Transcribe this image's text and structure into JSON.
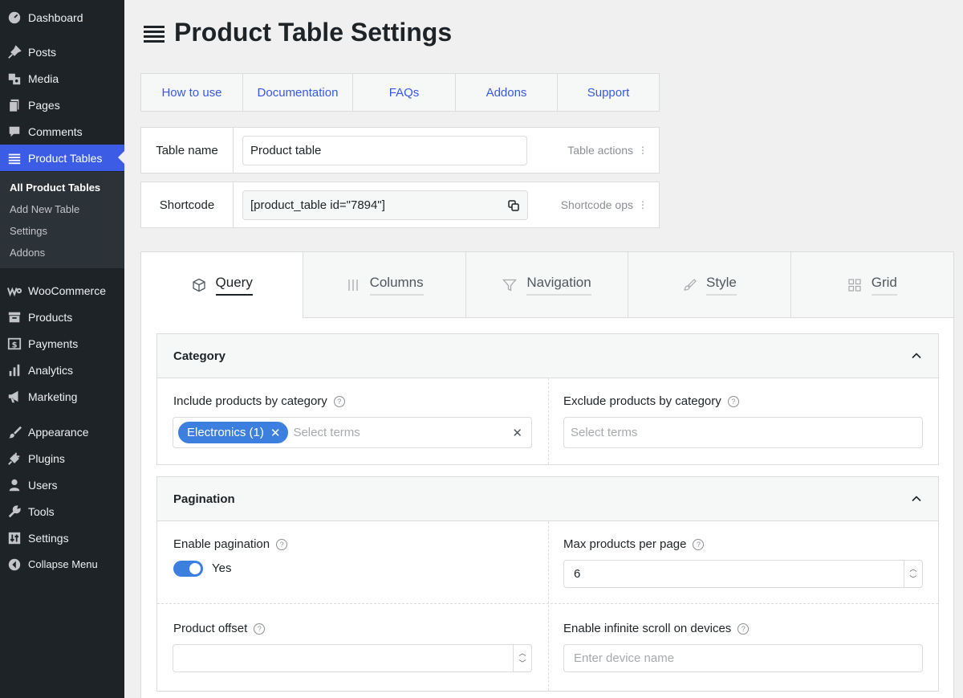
{
  "sidebar": {
    "items": [
      {
        "label": "Dashboard",
        "icon": "dashboard-icon"
      },
      {
        "label": "Posts",
        "icon": "pin-icon"
      },
      {
        "label": "Media",
        "icon": "media-icon"
      },
      {
        "label": "Pages",
        "icon": "pages-icon"
      },
      {
        "label": "Comments",
        "icon": "comment-icon"
      },
      {
        "label": "Product Tables",
        "icon": "list-icon"
      },
      {
        "label": "WooCommerce",
        "icon": "woocommerce-icon"
      },
      {
        "label": "Products",
        "icon": "archive-icon"
      },
      {
        "label": "Payments",
        "icon": "dollar-icon"
      },
      {
        "label": "Analytics",
        "icon": "bar-chart-icon"
      },
      {
        "label": "Marketing",
        "icon": "megaphone-icon"
      },
      {
        "label": "Appearance",
        "icon": "brush-icon"
      },
      {
        "label": "Plugins",
        "icon": "plug-icon"
      },
      {
        "label": "Users",
        "icon": "user-icon"
      },
      {
        "label": "Tools",
        "icon": "wrench-icon"
      },
      {
        "label": "Settings",
        "icon": "sliders-icon"
      },
      {
        "label": "Collapse Menu",
        "icon": "collapse-icon"
      }
    ],
    "submenu": [
      "All Product Tables",
      "Add New Table",
      "Settings",
      "Addons"
    ]
  },
  "header": {
    "title": "Product Table Settings"
  },
  "links": [
    "How to use",
    "Documentation",
    "FAQs",
    "Addons",
    "Support"
  ],
  "table_name": {
    "label": "Table name",
    "value": "Product table",
    "action": "Table actions"
  },
  "shortcode": {
    "label": "Shortcode",
    "value": "[product_table id=\"7894\"]",
    "action": "Shortcode ops"
  },
  "tabs": [
    "Query",
    "Columns",
    "Navigation",
    "Style",
    "Grid"
  ],
  "category": {
    "title": "Category",
    "include_label": "Include products by category",
    "include_chip": "Electronics (1)",
    "include_placeholder": "Select terms",
    "exclude_label": "Exclude products by category",
    "exclude_placeholder": "Select terms"
  },
  "pagination": {
    "title": "Pagination",
    "enable_label": "Enable pagination",
    "enable_value": "Yes",
    "max_label": "Max products per page",
    "max_value": "6",
    "offset_label": "Product offset",
    "offset_value": "",
    "infinite_label": "Enable infinite scroll on devices",
    "infinite_placeholder": "Enter device name"
  },
  "colors": {
    "accent": "#3c5ce6",
    "link": "#3858e9",
    "chip": "#3c7fde",
    "sidebar": "#1d2327"
  }
}
